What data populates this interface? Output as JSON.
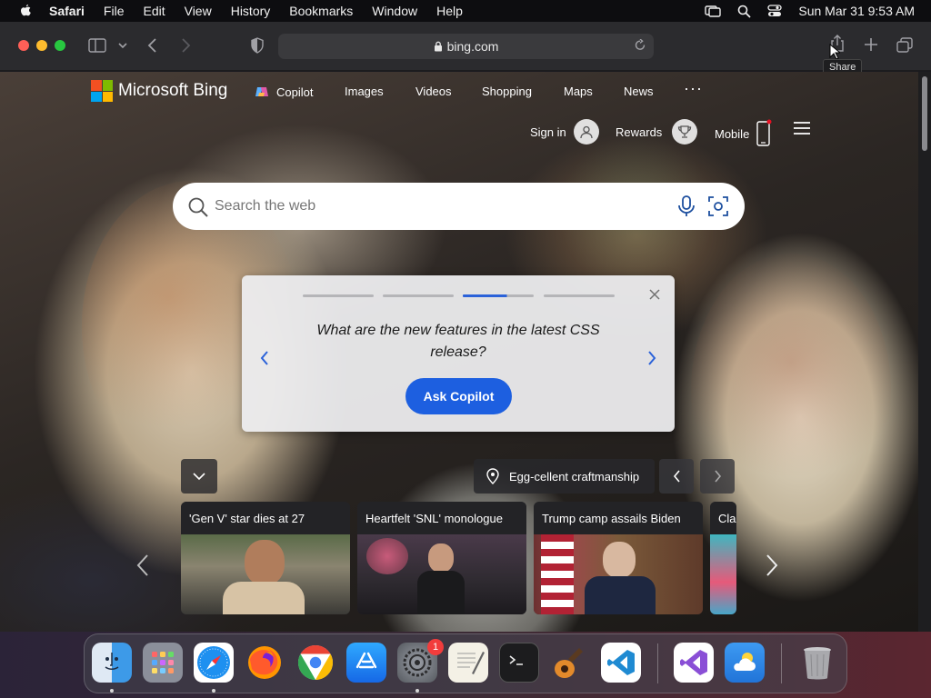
{
  "menubar": {
    "app": "Safari",
    "items": [
      "File",
      "Edit",
      "View",
      "History",
      "Bookmarks",
      "Window",
      "Help"
    ],
    "clock": "Sun Mar 31  9:53 AM"
  },
  "browser": {
    "url": "bing.com",
    "tooltip": "Share"
  },
  "bing": {
    "logo_text": "Microsoft Bing",
    "nav": {
      "copilot": "Copilot",
      "images": "Images",
      "videos": "Videos",
      "shopping": "Shopping",
      "maps": "Maps",
      "news": "News",
      "more": "···"
    },
    "sign_in": "Sign in",
    "rewards": "Rewards",
    "mobile": "Mobile",
    "search_placeholder": "Search the web"
  },
  "copilot_card": {
    "prompt": "What are the new features in the latest CSS release?",
    "button": "Ask Copilot",
    "active_step": 3,
    "total_steps": 4
  },
  "image_info": {
    "title": "Egg-cellent craftmanship"
  },
  "news": [
    {
      "title": "'Gen V' star dies at 27"
    },
    {
      "title": "Heartfelt 'SNL' monologue"
    },
    {
      "title": "Trump camp assails Biden"
    },
    {
      "title": "Clai"
    }
  ],
  "dock": {
    "apps": [
      "finder",
      "launchpad",
      "safari",
      "firefox",
      "chrome",
      "app-store",
      "system-settings",
      "textedit",
      "terminal",
      "garageband",
      "vscode",
      "visual-studio",
      "weather",
      "trash"
    ],
    "settings_badge": "1"
  },
  "colors": {
    "bing_blue": "#1d5fe0",
    "safari_chrome": "#2b2b2e",
    "menubar": "#0d0d10"
  }
}
